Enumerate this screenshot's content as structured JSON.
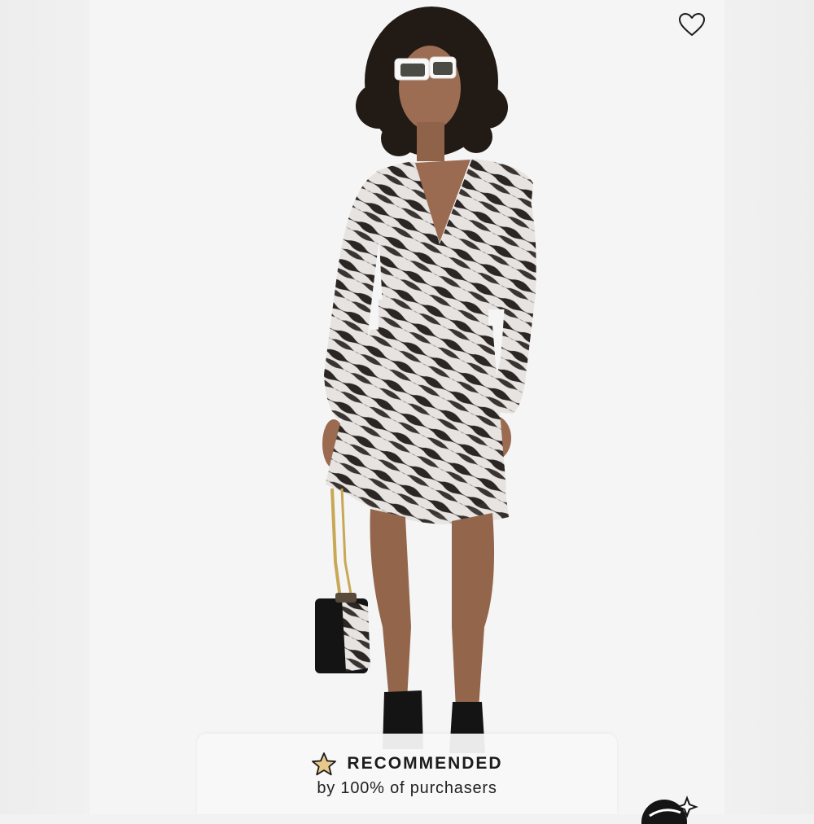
{
  "product_image": {
    "alt": "",
    "favorite_icon": "heart-outline-icon"
  },
  "recommendation": {
    "icon": "star-icon",
    "title": "RECOMMENDED",
    "subtitle": "by 100% of purchasers"
  },
  "corner_badge": {
    "icon": "sparkle-badge-icon"
  },
  "colors": {
    "background": "#f2f2f2",
    "card": "#f8f8f8",
    "star_fill": "#e9c98a",
    "text": "#1c1c1c"
  }
}
